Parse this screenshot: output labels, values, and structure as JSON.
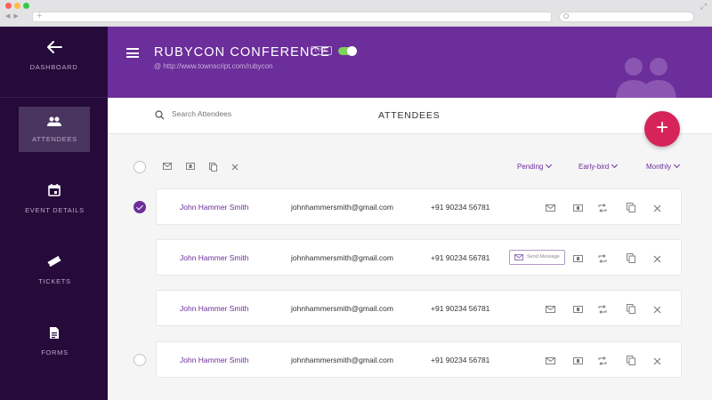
{
  "sidebar": {
    "items": [
      {
        "label": "DASHBOARD",
        "icon": "back-arrow-icon"
      },
      {
        "label": "ATTENDEES",
        "icon": "people-icon",
        "active": true
      },
      {
        "label": "EVENT DETAILS",
        "icon": "calendar-icon"
      },
      {
        "label": "TICKETS",
        "icon": "ticket-icon"
      },
      {
        "label": "FORMS",
        "icon": "document-icon"
      }
    ]
  },
  "header": {
    "title": "RUBYCON CONFERENCE",
    "badge": "LIVE",
    "live_toggle_on": true,
    "url": "@ http://www.townscript.com/rubycon"
  },
  "toolbar": {
    "search_placeholder": "Search Attendees",
    "page_title": "ATTENDEES",
    "add_button": "+"
  },
  "filters": [
    {
      "label": "Pending"
    },
    {
      "label": "Early-bird"
    },
    {
      "label": "Monthly"
    }
  ],
  "attendees": [
    {
      "name": "John Hammer Smith",
      "email": "johnhammersmith@gmail.com",
      "phone": "+91 90234 56781",
      "selected": true
    },
    {
      "name": "John Hammer Smith",
      "email": "johnhammersmith@gmail.com",
      "phone": "+91 90234 56781",
      "selected": false,
      "tooltip": "Send Message"
    },
    {
      "name": "John Hammer Smith",
      "email": "johnhammersmith@gmail.com",
      "phone": "+91 90234 56781",
      "selected": false
    },
    {
      "name": "John Hammer Smith",
      "email": "johnhammersmith@gmail.com",
      "phone": "+91 90234 56781",
      "selected": false
    }
  ],
  "colors": {
    "accent": "#6c2e9a",
    "sidebar": "#250a3a",
    "fab": "#d6245a",
    "toggle": "#7cd25a"
  }
}
